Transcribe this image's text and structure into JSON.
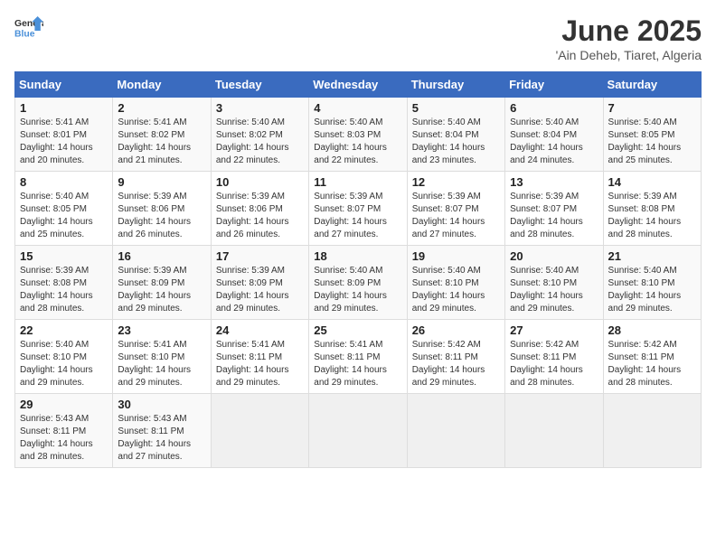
{
  "header": {
    "logo_general": "General",
    "logo_blue": "Blue",
    "title": "June 2025",
    "subtitle": "'Ain Deheb, Tiaret, Algeria"
  },
  "calendar": {
    "columns": [
      "Sunday",
      "Monday",
      "Tuesday",
      "Wednesday",
      "Thursday",
      "Friday",
      "Saturday"
    ],
    "rows": [
      [
        {
          "day": "1",
          "info": "Sunrise: 5:41 AM\nSunset: 8:01 PM\nDaylight: 14 hours and 20 minutes."
        },
        {
          "day": "2",
          "info": "Sunrise: 5:41 AM\nSunset: 8:02 PM\nDaylight: 14 hours and 21 minutes."
        },
        {
          "day": "3",
          "info": "Sunrise: 5:40 AM\nSunset: 8:02 PM\nDaylight: 14 hours and 22 minutes."
        },
        {
          "day": "4",
          "info": "Sunrise: 5:40 AM\nSunset: 8:03 PM\nDaylight: 14 hours and 22 minutes."
        },
        {
          "day": "5",
          "info": "Sunrise: 5:40 AM\nSunset: 8:04 PM\nDaylight: 14 hours and 23 minutes."
        },
        {
          "day": "6",
          "info": "Sunrise: 5:40 AM\nSunset: 8:04 PM\nDaylight: 14 hours and 24 minutes."
        },
        {
          "day": "7",
          "info": "Sunrise: 5:40 AM\nSunset: 8:05 PM\nDaylight: 14 hours and 25 minutes."
        }
      ],
      [
        {
          "day": "8",
          "info": "Sunrise: 5:40 AM\nSunset: 8:05 PM\nDaylight: 14 hours and 25 minutes."
        },
        {
          "day": "9",
          "info": "Sunrise: 5:39 AM\nSunset: 8:06 PM\nDaylight: 14 hours and 26 minutes."
        },
        {
          "day": "10",
          "info": "Sunrise: 5:39 AM\nSunset: 8:06 PM\nDaylight: 14 hours and 26 minutes."
        },
        {
          "day": "11",
          "info": "Sunrise: 5:39 AM\nSunset: 8:07 PM\nDaylight: 14 hours and 27 minutes."
        },
        {
          "day": "12",
          "info": "Sunrise: 5:39 AM\nSunset: 8:07 PM\nDaylight: 14 hours and 27 minutes."
        },
        {
          "day": "13",
          "info": "Sunrise: 5:39 AM\nSunset: 8:07 PM\nDaylight: 14 hours and 28 minutes."
        },
        {
          "day": "14",
          "info": "Sunrise: 5:39 AM\nSunset: 8:08 PM\nDaylight: 14 hours and 28 minutes."
        }
      ],
      [
        {
          "day": "15",
          "info": "Sunrise: 5:39 AM\nSunset: 8:08 PM\nDaylight: 14 hours and 28 minutes."
        },
        {
          "day": "16",
          "info": "Sunrise: 5:39 AM\nSunset: 8:09 PM\nDaylight: 14 hours and 29 minutes."
        },
        {
          "day": "17",
          "info": "Sunrise: 5:39 AM\nSunset: 8:09 PM\nDaylight: 14 hours and 29 minutes."
        },
        {
          "day": "18",
          "info": "Sunrise: 5:40 AM\nSunset: 8:09 PM\nDaylight: 14 hours and 29 minutes."
        },
        {
          "day": "19",
          "info": "Sunrise: 5:40 AM\nSunset: 8:10 PM\nDaylight: 14 hours and 29 minutes."
        },
        {
          "day": "20",
          "info": "Sunrise: 5:40 AM\nSunset: 8:10 PM\nDaylight: 14 hours and 29 minutes."
        },
        {
          "day": "21",
          "info": "Sunrise: 5:40 AM\nSunset: 8:10 PM\nDaylight: 14 hours and 29 minutes."
        }
      ],
      [
        {
          "day": "22",
          "info": "Sunrise: 5:40 AM\nSunset: 8:10 PM\nDaylight: 14 hours and 29 minutes."
        },
        {
          "day": "23",
          "info": "Sunrise: 5:41 AM\nSunset: 8:10 PM\nDaylight: 14 hours and 29 minutes."
        },
        {
          "day": "24",
          "info": "Sunrise: 5:41 AM\nSunset: 8:11 PM\nDaylight: 14 hours and 29 minutes."
        },
        {
          "day": "25",
          "info": "Sunrise: 5:41 AM\nSunset: 8:11 PM\nDaylight: 14 hours and 29 minutes."
        },
        {
          "day": "26",
          "info": "Sunrise: 5:42 AM\nSunset: 8:11 PM\nDaylight: 14 hours and 29 minutes."
        },
        {
          "day": "27",
          "info": "Sunrise: 5:42 AM\nSunset: 8:11 PM\nDaylight: 14 hours and 28 minutes."
        },
        {
          "day": "28",
          "info": "Sunrise: 5:42 AM\nSunset: 8:11 PM\nDaylight: 14 hours and 28 minutes."
        }
      ],
      [
        {
          "day": "29",
          "info": "Sunrise: 5:43 AM\nSunset: 8:11 PM\nDaylight: 14 hours and 28 minutes."
        },
        {
          "day": "30",
          "info": "Sunrise: 5:43 AM\nSunset: 8:11 PM\nDaylight: 14 hours and 27 minutes."
        },
        {
          "day": "",
          "info": ""
        },
        {
          "day": "",
          "info": ""
        },
        {
          "day": "",
          "info": ""
        },
        {
          "day": "",
          "info": ""
        },
        {
          "day": "",
          "info": ""
        }
      ]
    ]
  }
}
